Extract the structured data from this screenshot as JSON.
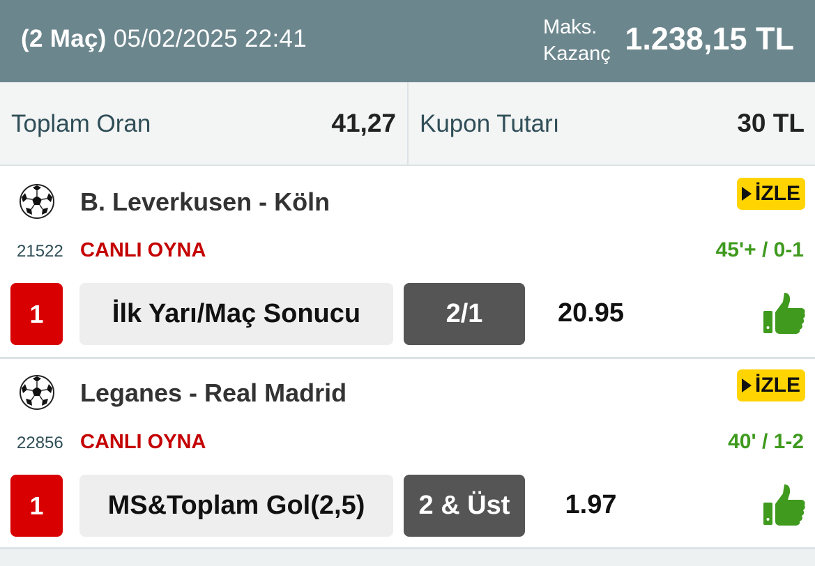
{
  "header": {
    "match_count": "(2 Maç)",
    "datetime": "05/02/2025 22:41",
    "max_label_line1": "Maks.",
    "max_label_line2": "Kazanç",
    "max_amount": "1.238,15 TL"
  },
  "summary": {
    "total_odds_label": "Toplam Oran",
    "total_odds_value": "41,27",
    "coupon_amount_label": "Kupon Tutarı",
    "coupon_amount_value": "30 TL"
  },
  "matches": [
    {
      "teams": "B. Leverkusen - Köln",
      "watch_label": "İZLE",
      "code": "21522",
      "live_label": "CANLI OYNA",
      "status": "45'+ / 0-1",
      "pick_no": "1",
      "market": "İlk Yarı/Maç Sonucu",
      "selection": "2/1",
      "odds": "20.95",
      "icon": "thumbs-up-icon"
    },
    {
      "teams": "Leganes - Real Madrid",
      "watch_label": "İZLE",
      "code": "22856",
      "live_label": "CANLI OYNA",
      "status": "40' / 1-2",
      "pick_no": "1",
      "market": "MS&Toplam Gol(2,5)",
      "selection": "2 & Üst",
      "odds": "1.97",
      "icon": "thumbs-up-icon"
    }
  ],
  "colors": {
    "header_bg": "#6c868d",
    "live_red": "#c40000",
    "status_green": "#3f9a1e",
    "watch_yellow": "#ffd400",
    "pick_red": "#d80000",
    "selection_gray": "#555555"
  }
}
